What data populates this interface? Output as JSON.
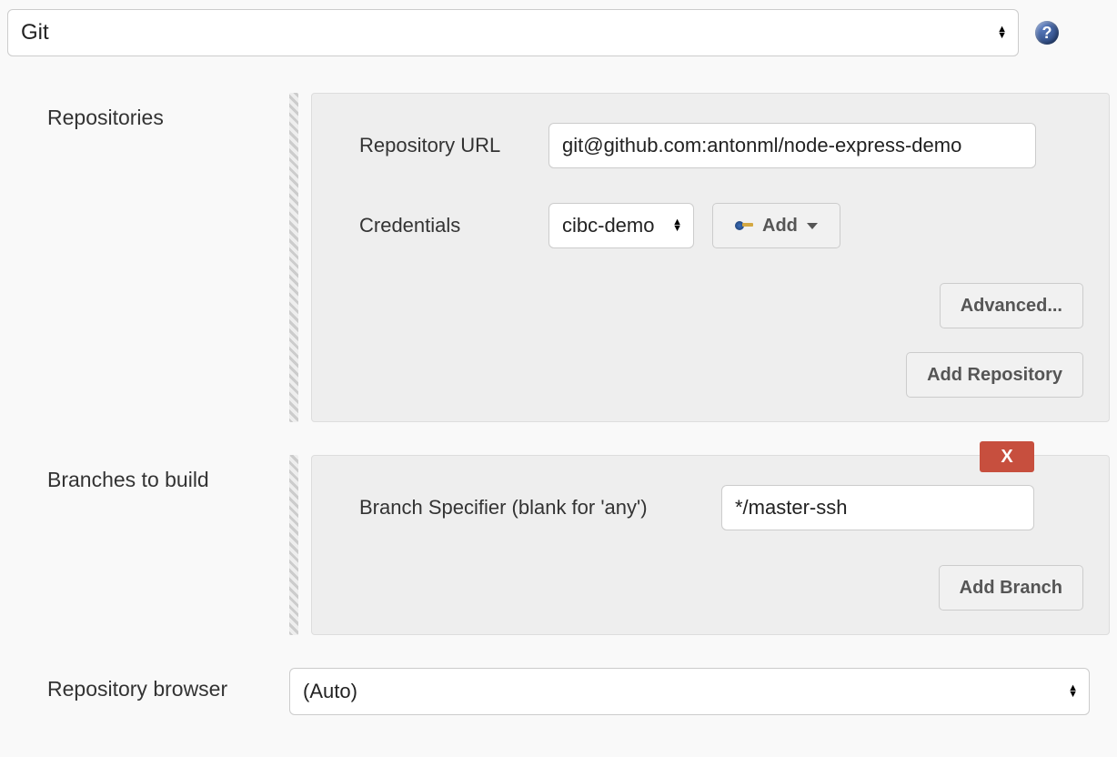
{
  "scm": {
    "selected": "Git"
  },
  "repositories": {
    "label": "Repositories",
    "repo_url_label": "Repository URL",
    "repo_url_value": "git@github.com:antonml/node-express-demo",
    "credentials_label": "Credentials",
    "credentials_selected": "cibc-demo",
    "add_button": "Add",
    "advanced_button": "Advanced...",
    "add_repo_button": "Add Repository"
  },
  "branches": {
    "label": "Branches to build",
    "specifier_label": "Branch Specifier (blank for 'any')",
    "specifier_value": "*/master-ssh",
    "add_branch_button": "Add Branch",
    "delete_label": "X"
  },
  "browser": {
    "label": "Repository browser",
    "selected": "(Auto)"
  }
}
